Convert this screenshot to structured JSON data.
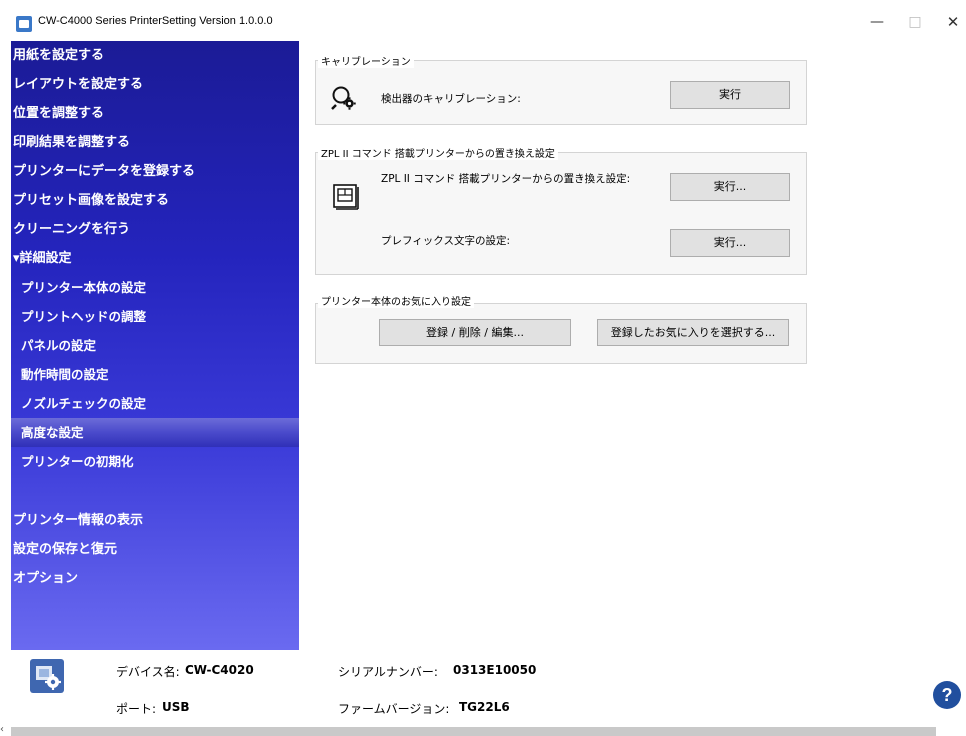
{
  "window": {
    "title": "CW-C4000 Series PrinterSetting Version 1.0.0.0",
    "controls": {
      "minimize": "—",
      "maximize": "□",
      "close": "✕"
    }
  },
  "sidebar": {
    "items": [
      {
        "label": "用紙を設定する",
        "level": "top"
      },
      {
        "label": "レイアウトを設定する",
        "level": "top"
      },
      {
        "label": "位置を調整する",
        "level": "top"
      },
      {
        "label": "印刷結果を調整する",
        "level": "top"
      },
      {
        "label": "プリンターにデータを登録する",
        "level": "top"
      },
      {
        "label": "プリセット画像を設定する",
        "level": "top"
      },
      {
        "label": "クリーニングを行う",
        "level": "top"
      },
      {
        "label": "▾詳細設定",
        "level": "top"
      },
      {
        "label": "プリンター本体の設定",
        "level": "sub"
      },
      {
        "label": "プリントヘッドの調整",
        "level": "sub"
      },
      {
        "label": "パネルの設定",
        "level": "sub"
      },
      {
        "label": "動作時間の設定",
        "level": "sub"
      },
      {
        "label": "ノズルチェックの設定",
        "level": "sub"
      },
      {
        "label": "高度な設定",
        "level": "sub",
        "selected": true
      },
      {
        "label": "プリンターの初期化",
        "level": "sub"
      },
      {
        "label": "プリンター情報の表示",
        "level": "top"
      },
      {
        "label": "設定の保存と復元",
        "level": "top"
      },
      {
        "label": "オプション",
        "level": "top"
      }
    ]
  },
  "main": {
    "calibration": {
      "group_title": "キャリブレーション",
      "label": "検出器のキャリブレーション:",
      "button": "実行"
    },
    "zpl": {
      "group_title": "ZPL II コマンド 搭載プリンターからの置き換え設定",
      "replace_label": "ZPL II コマンド 搭載プリンターからの置き換え設定:",
      "replace_button": "実行...",
      "prefix_label": "プレフィックス文字の設定:",
      "prefix_button": "実行..."
    },
    "favorites": {
      "group_title": "プリンター本体のお気に入り設定",
      "register_button": "登録 / 削除 / 編集...",
      "select_button": "登録したお気に入りを選択する..."
    }
  },
  "footer": {
    "device_name_label": "デバイス名:",
    "device_name_value": "CW-C4020",
    "port_label": "ポート:",
    "port_value": "USB",
    "serial_label": "シリアルナンバー:",
    "serial_value": "0313E10050",
    "firmware_label": "ファームバージョン:",
    "firmware_value": "TG22L6",
    "help": "?"
  },
  "colors": {
    "sidebar_top": "#1b1b96",
    "sidebar_bottom": "#6a6af0",
    "selected": "#4a4acb",
    "help": "#214f9e"
  }
}
